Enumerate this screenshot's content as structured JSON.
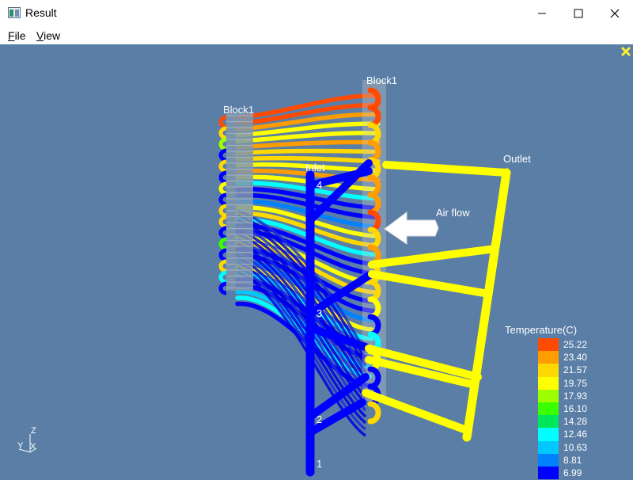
{
  "window": {
    "title": "Result",
    "icons": {
      "app": "app-icon",
      "minimize": "minimize-icon",
      "maximize": "maximize-icon",
      "close": "close-icon"
    }
  },
  "menu": {
    "items": [
      {
        "label_first": "F",
        "label_rest": "ile"
      },
      {
        "label_first": "V",
        "label_rest": "iew"
      }
    ]
  },
  "scene": {
    "background": "#5a7ea6",
    "labels": {
      "block_left": "Block1",
      "block_right": "Block1",
      "inlet": "Inlet",
      "outlet": "Outlet",
      "air_flow": "Air flow",
      "num_1": "1",
      "num_2": "2",
      "num_3": "3",
      "num_4": "4"
    },
    "axes": {
      "z": "Z",
      "y": "Y",
      "x": "X"
    },
    "corner_icon": "close-icon"
  },
  "legend": {
    "title": "Temperature(C)",
    "values": [
      "25.22",
      "23.40",
      "21.57",
      "19.75",
      "17.93",
      "16.10",
      "14.28",
      "12.46",
      "10.63",
      "8.81",
      "6.99"
    ],
    "colors": [
      "#ff4a00",
      "#ff9c00",
      "#ffd800",
      "#ffff00",
      "#9dff00",
      "#39ff00",
      "#00e65a",
      "#00ffff",
      "#00c8ff",
      "#0082ff",
      "#0000ff"
    ]
  }
}
